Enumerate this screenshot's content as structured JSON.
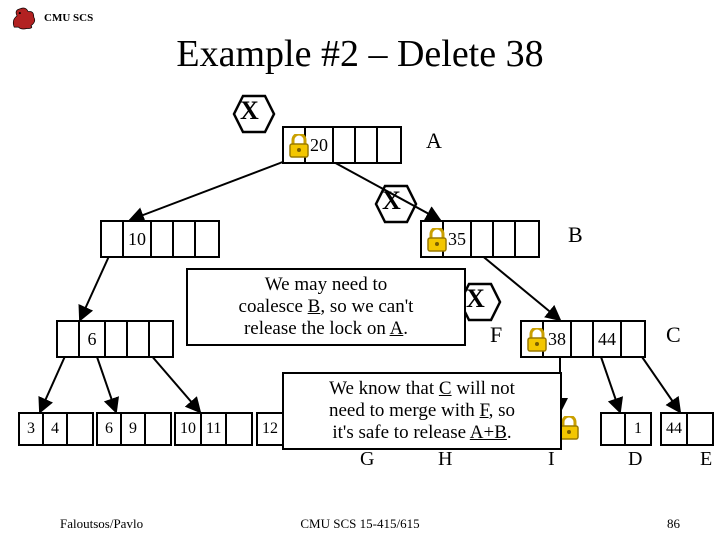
{
  "header": {
    "org": "CMU SCS"
  },
  "title": "Example #2 – Delete 38",
  "footer": {
    "left": "Faloutsos/Pavlo",
    "center": "CMU SCS 15-415/615",
    "page": "86"
  },
  "marks": {
    "X": "X"
  },
  "labels": {
    "A": "A",
    "B": "B",
    "C": "C",
    "D": "D",
    "E": "E",
    "F": "F",
    "G": "G",
    "H": "H",
    "I": "I"
  },
  "nodes": {
    "root": {
      "k0": "20"
    },
    "l1a": {
      "k0": "10"
    },
    "l1b": {
      "k0": "35"
    },
    "l2a": {
      "k0": "6"
    },
    "l2c": {
      "k0": "38",
      "k1": "44"
    },
    "leaf1": {
      "a": "3",
      "b": "4"
    },
    "leaf2": {
      "a": "6",
      "b": "9"
    },
    "leaf3": {
      "a": "10",
      "b": "11"
    },
    "leaf4": {
      "a": "12"
    },
    "leaf7": {
      "b": "1"
    },
    "leaf8": {
      "a": "44"
    }
  },
  "notes": {
    "n1a": "We may need to",
    "n1b_pre": "coalesce ",
    "n1b_u": "B",
    "n1b_post": ", so we can't",
    "n1c_pre": "release the lock on ",
    "n1c_u": "A",
    "n1c_post": ".",
    "n2a_pre": "We know that ",
    "n2a_u": "C",
    "n2a_post": " will not",
    "n2b_pre": "need to merge with ",
    "n2b_u": "F",
    "n2b_post": ", so",
    "n2c_pre": "it's safe to release ",
    "n2c_u": "A+B",
    "n2c_post": "."
  }
}
